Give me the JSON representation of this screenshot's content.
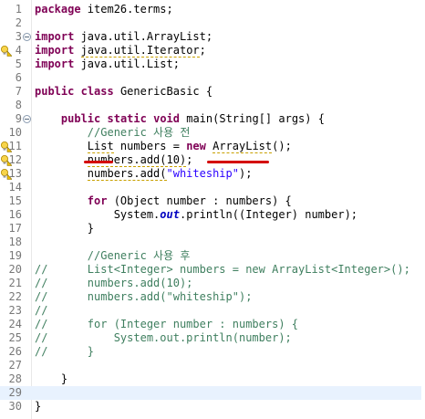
{
  "editor": {
    "lines": [
      {
        "n": "1",
        "tokens": [
          {
            "t": "package",
            "c": "kw"
          },
          {
            "t": " item26.terms;"
          }
        ]
      },
      {
        "n": "2",
        "tokens": []
      },
      {
        "n": "3",
        "fold": true,
        "tokens": [
          {
            "t": "import",
            "c": "kw"
          },
          {
            "t": " java.util.ArrayList;"
          }
        ]
      },
      {
        "n": "4",
        "marker": "warning",
        "tokens": [
          {
            "t": "import",
            "c": "kw"
          },
          {
            "t": " "
          },
          {
            "t": "java.util.Iterator",
            "c": "warn"
          },
          {
            "t": ";"
          }
        ]
      },
      {
        "n": "5",
        "tokens": [
          {
            "t": "import",
            "c": "kw"
          },
          {
            "t": " java.util.List;"
          }
        ]
      },
      {
        "n": "6",
        "tokens": []
      },
      {
        "n": "7",
        "tokens": [
          {
            "t": "public",
            "c": "kw"
          },
          {
            "t": " "
          },
          {
            "t": "class",
            "c": "kw"
          },
          {
            "t": " GenericBasic {"
          }
        ]
      },
      {
        "n": "8",
        "tokens": []
      },
      {
        "n": "9",
        "fold": true,
        "tokens": [
          {
            "t": "    "
          },
          {
            "t": "public",
            "c": "kw"
          },
          {
            "t": " "
          },
          {
            "t": "static",
            "c": "kw"
          },
          {
            "t": " "
          },
          {
            "t": "void",
            "c": "kw"
          },
          {
            "t": " main(String[] args) {"
          }
        ]
      },
      {
        "n": "10",
        "tokens": [
          {
            "t": "        "
          },
          {
            "t": "//Generic 사용 전",
            "c": "cm"
          }
        ]
      },
      {
        "n": "11",
        "marker": "warning",
        "tokens": [
          {
            "t": "        "
          },
          {
            "t": "List",
            "c": "warn"
          },
          {
            "t": " numbers = "
          },
          {
            "t": "new",
            "c": "kw"
          },
          {
            "t": " "
          },
          {
            "t": "ArrayList",
            "c": "warn"
          },
          {
            "t": "();"
          }
        ]
      },
      {
        "n": "12",
        "marker": "warning",
        "tokens": [
          {
            "t": "        "
          },
          {
            "t": "numbers.add(10)",
            "c": "warn"
          },
          {
            "t": ";"
          }
        ]
      },
      {
        "n": "13",
        "marker": "warning",
        "tokens": [
          {
            "t": "        "
          },
          {
            "t": "numbers.add(",
            "c": "warn"
          },
          {
            "t": "\"whiteship\"",
            "c": "str"
          },
          {
            "t": ");"
          }
        ]
      },
      {
        "n": "14",
        "tokens": []
      },
      {
        "n": "15",
        "tokens": [
          {
            "t": "        "
          },
          {
            "t": "for",
            "c": "kw"
          },
          {
            "t": " (Object number : numbers) {"
          }
        ]
      },
      {
        "n": "16",
        "tokens": [
          {
            "t": "            System."
          },
          {
            "t": "out",
            "c": "st"
          },
          {
            "t": ".println((Integer) number);"
          }
        ]
      },
      {
        "n": "17",
        "tokens": [
          {
            "t": "        }"
          }
        ]
      },
      {
        "n": "18",
        "tokens": []
      },
      {
        "n": "19",
        "tokens": [
          {
            "t": "        "
          },
          {
            "t": "//Generic 사용 후",
            "c": "cm"
          }
        ]
      },
      {
        "n": "20",
        "tokens": [
          {
            "t": "//",
            "c": "cm"
          },
          {
            "t": "      List<Integer> numbers = new ArrayList<Integer>();",
            "c": "cm"
          }
        ]
      },
      {
        "n": "21",
        "tokens": [
          {
            "t": "//",
            "c": "cm"
          },
          {
            "t": "      numbers.add(10);",
            "c": "cm"
          }
        ]
      },
      {
        "n": "22",
        "tokens": [
          {
            "t": "//",
            "c": "cm"
          },
          {
            "t": "      numbers.add(\"whiteship\");",
            "c": "cm"
          }
        ]
      },
      {
        "n": "23",
        "tokens": [
          {
            "t": "//",
            "c": "cm"
          }
        ]
      },
      {
        "n": "24",
        "tokens": [
          {
            "t": "//",
            "c": "cm"
          },
          {
            "t": "      for (Integer number : numbers) {",
            "c": "cm"
          }
        ]
      },
      {
        "n": "25",
        "tokens": [
          {
            "t": "//",
            "c": "cm"
          },
          {
            "t": "          System.out.println(number);",
            "c": "cm"
          }
        ]
      },
      {
        "n": "26",
        "tokens": [
          {
            "t": "//",
            "c": "cm"
          },
          {
            "t": "      }",
            "c": "cm"
          }
        ]
      },
      {
        "n": "27",
        "tokens": []
      },
      {
        "n": "28",
        "tokens": [
          {
            "t": "    }"
          }
        ]
      },
      {
        "n": "29",
        "current": true,
        "tokens": []
      },
      {
        "n": "30",
        "tokens": [
          {
            "t": "}"
          }
        ]
      }
    ]
  },
  "colors": {
    "keyword": "#7f0055",
    "comment": "#3f7f5f",
    "string": "#2a00ff",
    "static_field": "#0000c0",
    "current_line": "#e8f2fe",
    "annotation_red": "#d40000",
    "warning": "#f0c000"
  },
  "icons": {
    "warning": "warning-lightbulb-icon",
    "fold": "fold-collapse-icon"
  }
}
